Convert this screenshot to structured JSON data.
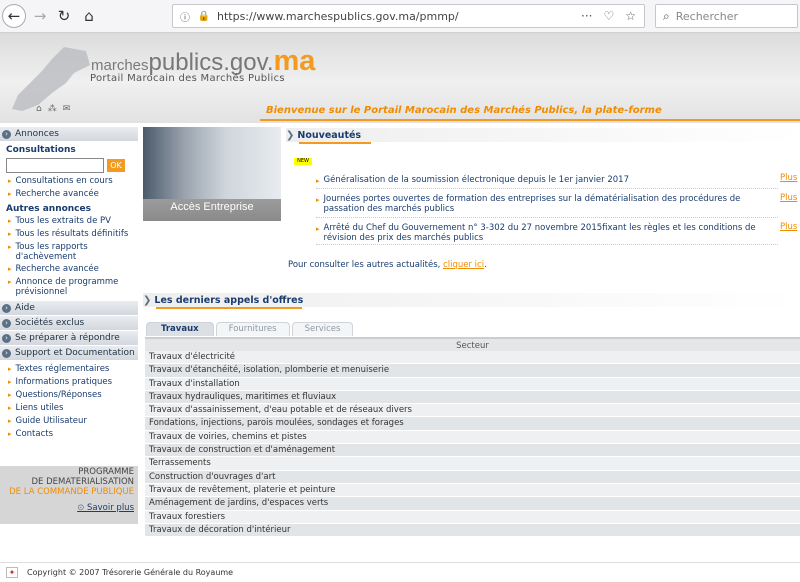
{
  "browser": {
    "url": "https://www.marchespublics.gov.ma/pmmp/",
    "search_placeholder": "Rechercher"
  },
  "header": {
    "logo_part1": "marches",
    "logo_part2": "publics",
    "logo_part3": ".gov.",
    "logo_part4": "ma",
    "tagline": "Portail Marocain des Marchés Publics",
    "welcome": "Bienvenue sur le Portail Marocain des Marchés Publics, la plate-forme"
  },
  "sidebar": {
    "annonces": "Annonces",
    "consultations_title": "Consultations",
    "ok_label": "OK",
    "consultations_items": [
      "Consultations en cours",
      "Recherche avancée"
    ],
    "autres_title": "Autres annonces",
    "autres_items": [
      "Tous les extraits de PV",
      "Tous les résultats définitifs",
      "Tous les rapports d'achèvement",
      "Recherche avancée",
      "Annonce de programme prévisionnel"
    ],
    "aide": "Aide",
    "societes": "Sociétés exclus",
    "preparer": "Se préparer à répondre",
    "support": "Support et Documentation",
    "support_items": [
      "Textes réglementaires",
      "Informations pratiques",
      "Questions/Réponses",
      "Liens utiles",
      "Guide Utilisateur",
      "Contacts"
    ],
    "promo_line1": "PROGRAMME",
    "promo_line2": "DE DEMATERIALISATION",
    "promo_line3": "DE LA COMMANDE PUBLIQUE",
    "promo_more": "Savoir plus"
  },
  "access": {
    "label": "Accès Entreprise"
  },
  "news": {
    "title": "Nouveautés",
    "badge": "NEW",
    "items": [
      "Généralisation de la soumission électronique depuis le 1er janvier 2017",
      "Journées portes ouvertes de formation des entreprises sur la dématérialisation des procédures de passation des marchés publics",
      "Arrêté du Chef du Gouvernement n° 3-302 du 27 novembre 2015fixant les règles et les conditions de révision des prix des marchés publics"
    ],
    "plus": "Plus",
    "footer_text": "Pour consulter les autres actualités, ",
    "footer_link": "cliquer ici",
    "footer_end": "."
  },
  "tenders": {
    "title": "Les derniers appels d'offres",
    "tabs": [
      "Travaux",
      "Fournitures",
      "Services"
    ],
    "column": "Secteur",
    "rows": [
      "Travaux d'électricité",
      "Travaux d'étanchéité, isolation, plomberie et menuiserie",
      "Travaux d'installation",
      "Travaux hydrauliques, maritimes et fluviaux",
      "Travaux d'assainissement, d'eau potable et de réseaux divers",
      "Fondations, injections, parois moulées, sondages et forages",
      "Travaux de voiries, chemins et pistes",
      "Travaux de construction et d'aménagement",
      "Terrassements",
      "Construction d'ouvrages d'art",
      "Travaux de revêtement, platerie et peinture",
      "Aménagement de jardins, d'espaces verts",
      "Travaux forestiers",
      "Travaux de décoration d'intérieur"
    ]
  },
  "footer": {
    "copyright": "Copyright © 2007 Trésorerie Générale du Royaume"
  }
}
